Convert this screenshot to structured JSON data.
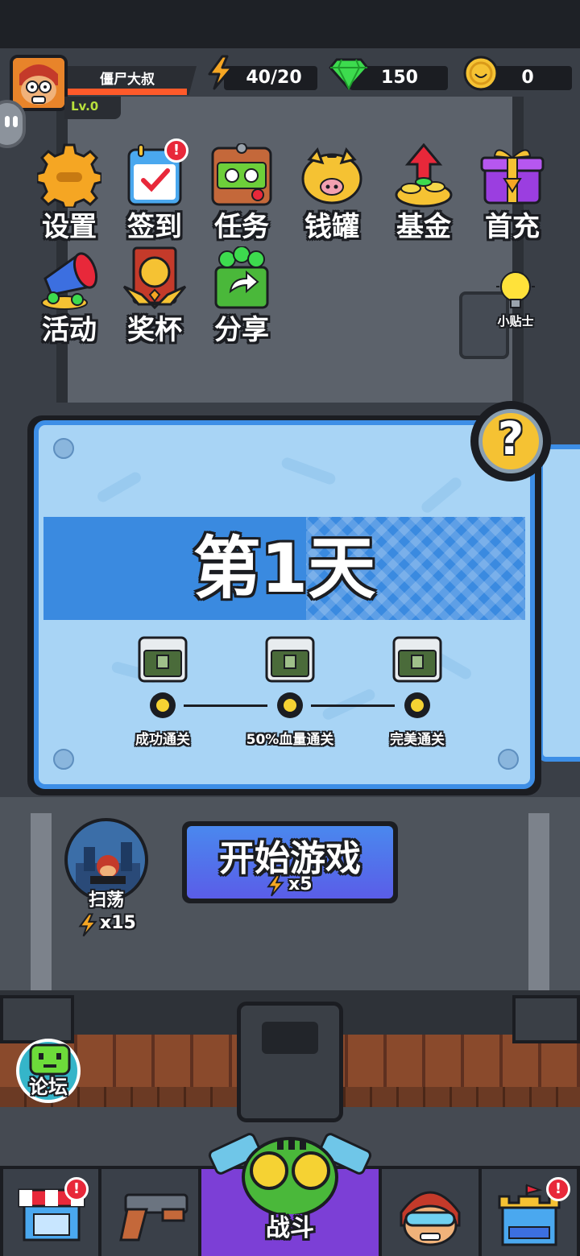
{
  "player": {
    "name": "僵尸大叔",
    "level": "Lv.0"
  },
  "resources": {
    "energy": "40/20",
    "gems": "150",
    "coins": "0"
  },
  "features": [
    {
      "label": "设置",
      "icon": "gear-icon"
    },
    {
      "label": "签到",
      "icon": "calendar-icon",
      "badge": "!"
    },
    {
      "label": "任务",
      "icon": "task-box-icon"
    },
    {
      "label": "钱罐",
      "icon": "piggy-bank-icon"
    },
    {
      "label": "基金",
      "icon": "fund-coins-icon"
    },
    {
      "label": "首充",
      "icon": "gift-box-icon"
    },
    {
      "label": "活动",
      "icon": "megaphone-icon"
    },
    {
      "label": "奖杯",
      "icon": "trophy-icon"
    },
    {
      "label": "分享",
      "icon": "share-icon"
    }
  ],
  "tips": {
    "label": "小贴士",
    "icon": "lightbulb-icon"
  },
  "level_card": {
    "title": "第1天",
    "help": "?",
    "objectives": [
      {
        "label": "成功通关"
      },
      {
        "label": "50%血量通关"
      },
      {
        "label": "完美通关"
      }
    ]
  },
  "start": {
    "label": "开始游戏",
    "cost": "x5"
  },
  "sweep": {
    "label": "扫荡",
    "cost": "x15"
  },
  "forum": {
    "label": "论坛"
  },
  "bottom_nav": {
    "active_label": "战斗",
    "badge": "!"
  },
  "colors": {
    "accent_blue": "#3d8ee6",
    "active_tab": "#7c3fd6",
    "badge_red": "#e8283a",
    "energy_yellow": "#f5a623"
  }
}
